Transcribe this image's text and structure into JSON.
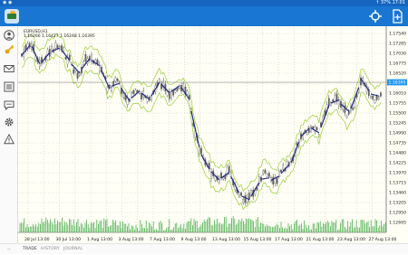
{
  "statusbar": {
    "battery": "37%",
    "time": "17:01"
  },
  "toolbar": {
    "logo": "app-logo-icon",
    "actions": [
      "crosshair-icon",
      "new-order-icon"
    ]
  },
  "sidebar": {
    "icons": [
      "account-icon",
      "key-icon",
      "mail-icon",
      "news-icon",
      "chat-icon",
      "settings-icon",
      "alerts-icon"
    ]
  },
  "chart": {
    "symbol": "EURUSD,H1",
    "ohlc": "1.16266 1.16427 1.16248 1.16395",
    "current_price": "1.16395",
    "y_ticks": [
      "1.17540",
      "1.17285",
      "1.17030",
      "1.16775",
      "1.16520",
      "1.16265",
      "1.16010",
      "1.15755",
      "1.15500",
      "1.15245",
      "1.14990",
      "1.14735",
      "1.14480",
      "1.14225",
      "1.13970",
      "1.13715",
      "1.13460",
      "1.13205",
      "1.12950",
      "1.12695"
    ],
    "x_ticks": [
      "28 Jul 13:00",
      "30 Jul 13:00",
      "1 Aug 13:00",
      "3 Aug 13:00",
      "7 Aug 13:00",
      "9 Aug 13:00",
      "13 Aug 13:00",
      "15 Aug 13:00",
      "17 Aug 13:00",
      "21 Aug 13:00",
      "23 Aug 13:00",
      "27 Aug 13:00"
    ],
    "colors": {
      "candle": "#444444",
      "band": "#9acd32",
      "ma": "#1a237e",
      "grid": "#b8b8b8",
      "price_line": "#2196f3"
    }
  },
  "tabs": {
    "nav": "‹›",
    "items": [
      "TRADE",
      "HISTORY",
      "JOURNAL"
    ]
  }
}
